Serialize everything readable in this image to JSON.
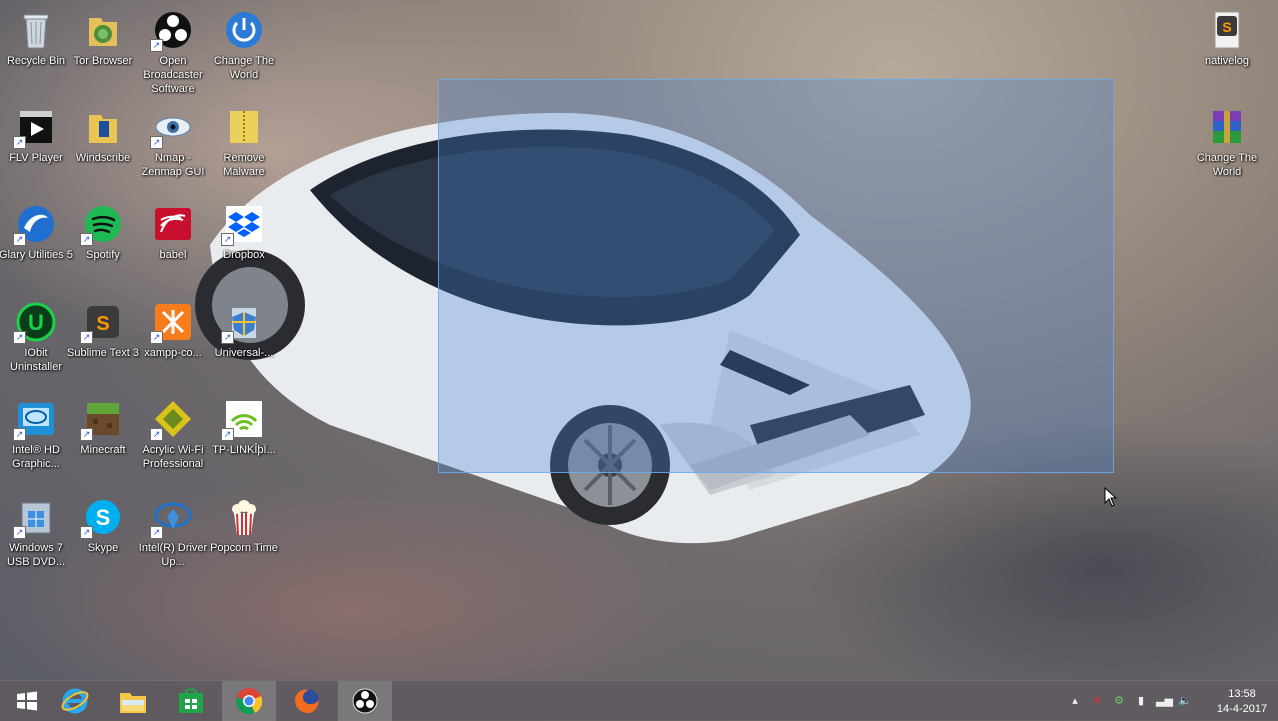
{
  "desktop": {
    "icons": [
      {
        "label": "Recycle Bin",
        "icon": "recycle-bin-icon"
      },
      {
        "label": "Tor Browser",
        "icon": "tor-browser-icon"
      },
      {
        "label": "Open Broadcaster Software",
        "icon": "obs-icon"
      },
      {
        "label": "Change The World",
        "icon": "power-icon"
      },
      {
        "label": "FLV Player",
        "icon": "flv-player-icon"
      },
      {
        "label": "Windscribe",
        "icon": "windscribe-folder-icon"
      },
      {
        "label": "Nmap - Zenmap GUI",
        "icon": "nmap-eye-icon"
      },
      {
        "label": "Remove Malware",
        "icon": "folder-zipper-icon"
      },
      {
        "label": "Glary Utilities 5",
        "icon": "glary-icon"
      },
      {
        "label": "Spotify",
        "icon": "spotify-icon"
      },
      {
        "label": "babel",
        "icon": "babel-icon"
      },
      {
        "label": "Dropbox",
        "icon": "dropbox-icon"
      },
      {
        "label": "IObit Uninstaller",
        "icon": "iobit-icon"
      },
      {
        "label": "Sublime Text 3",
        "icon": "sublime-icon"
      },
      {
        "label": "xampp-co...",
        "icon": "xampp-icon"
      },
      {
        "label": "Universal-...",
        "icon": "universal-shield-icon"
      },
      {
        "label": "Intel® HD Graphic...",
        "icon": "intel-graphics-icon"
      },
      {
        "label": "Minecraft",
        "icon": "minecraft-icon"
      },
      {
        "label": "Acrylic Wi-Fi Professional",
        "icon": "acrylic-wifi-icon"
      },
      {
        "label": "TP-LINKÎþÏ...",
        "icon": "tplink-wifi-icon"
      },
      {
        "label": "Windows 7 USB DVD...",
        "icon": "windows-usb-icon"
      },
      {
        "label": "Skype",
        "icon": "skype-icon"
      },
      {
        "label": "Intel(R) Driver Up...",
        "icon": "intel-driver-icon"
      },
      {
        "label": "Popcorn Time",
        "icon": "popcorn-icon"
      },
      {
        "label": "nativelog",
        "icon": "sublime-file-icon"
      },
      {
        "label": "Change The World",
        "icon": "winrar-icon"
      }
    ]
  },
  "taskbar": {
    "apps": [
      {
        "name": "Start",
        "icon": "windows-start-icon"
      },
      {
        "name": "Internet Explorer",
        "icon": "ie-icon"
      },
      {
        "name": "File Explorer",
        "icon": "file-explorer-icon"
      },
      {
        "name": "Store",
        "icon": "store-icon"
      },
      {
        "name": "Google Chrome",
        "icon": "chrome-icon"
      },
      {
        "name": "Firefox",
        "icon": "firefox-icon"
      },
      {
        "name": "OBS",
        "icon": "obs-taskbar-icon"
      }
    ],
    "clock": {
      "time": "13:58",
      "date": "14-4-2017"
    }
  },
  "colors": {
    "selection": "#4682d2",
    "taskbar": "#5f5a5f"
  }
}
